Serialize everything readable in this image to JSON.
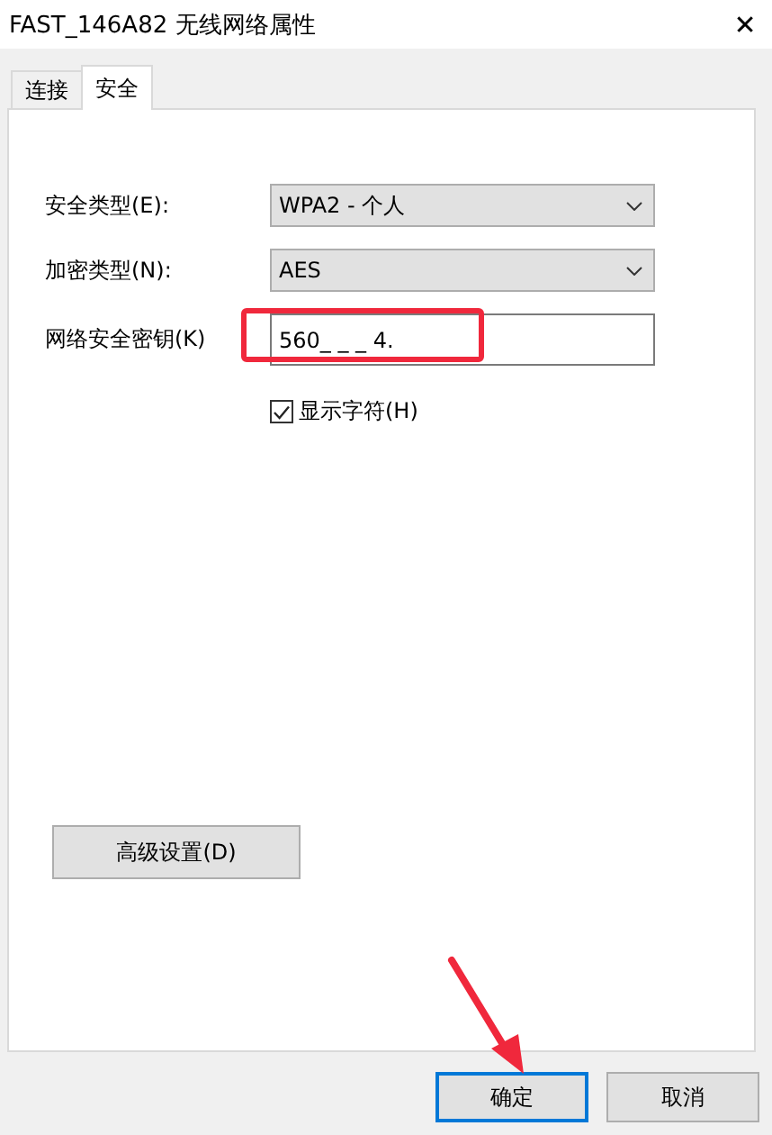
{
  "window": {
    "title": "FAST_146A82 无线网络属性",
    "close": "✕"
  },
  "tabs": [
    {
      "label": "连接",
      "selected": false
    },
    {
      "label": "安全",
      "selected": true
    }
  ],
  "fields": [
    {
      "kind": "dropdown",
      "label": "安全类型(E):",
      "value": "WPA2 - 个人"
    },
    {
      "kind": "dropdown",
      "label": "加密类型(N):",
      "value": "AES"
    },
    {
      "kind": "text",
      "label": "网络安全密钥(K)",
      "value": "560_ _ _ 4.",
      "highlighted": true
    }
  ],
  "show_characters": {
    "label": "显示字符(H)",
    "checked": true
  },
  "advanced_button": "高级设置(D)",
  "buttons": [
    {
      "label": "确定",
      "focused": true
    },
    {
      "label": "取消",
      "focused": false
    }
  ],
  "annotation_arrow": true
}
